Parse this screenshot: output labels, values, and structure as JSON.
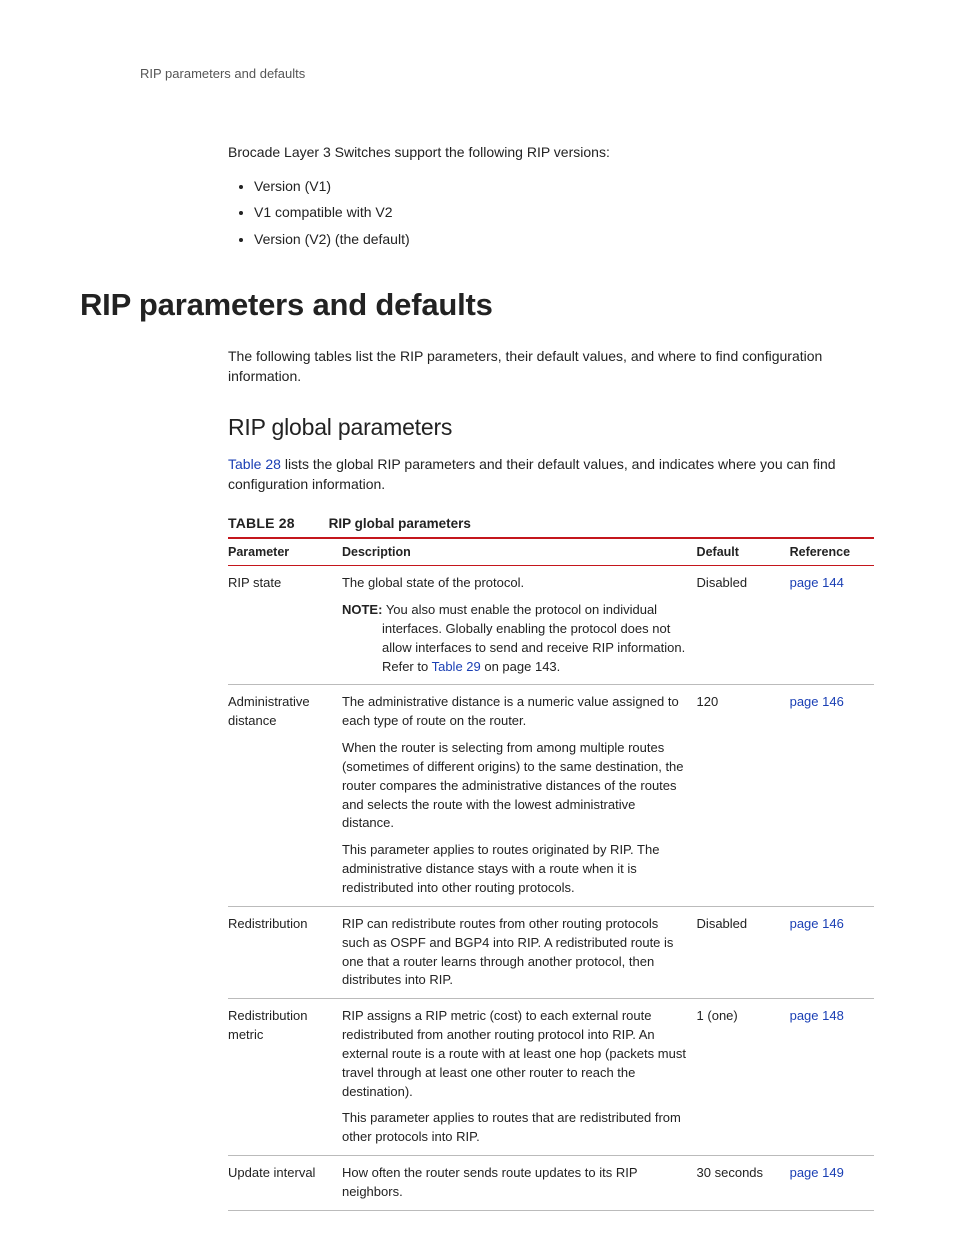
{
  "running_head": "RIP parameters and defaults",
  "intro_sentence": "Brocade Layer 3 Switches support the following RIP versions:",
  "versions": [
    "Version (V1)",
    "V1 compatible with V2",
    "Version (V2) (the default)"
  ],
  "section_heading": "RIP parameters and defaults",
  "section_para": "The following tables list the RIP parameters, their default values, and where to find configuration information.",
  "sub_heading": "RIP global parameters",
  "sub_para_pre_link": "Table 28",
  "sub_para_post_link": " lists the global RIP parameters and their default values, and indicates where you can find configuration information.",
  "table_number": "TABLE 28",
  "table_title": "RIP global parameters",
  "columns": {
    "param": "Parameter",
    "desc": "Description",
    "def": "Default",
    "ref": "Reference"
  },
  "rows": [
    {
      "param": "RIP state",
      "desc_main": "The global state of the protocol.",
      "note_label": "NOTE:",
      "note_text": "You also must enable the protocol on individual interfaces.  Globally enabling the protocol does not allow interfaces to send and receive RIP information.  Refer to ",
      "note_link": "Table 29",
      "note_tail": " on page 143.",
      "default": "Disabled",
      "reference": "page 144"
    },
    {
      "param": "Administrative distance",
      "desc_main": "The administrative distance is a numeric value assigned to each type of route on the router.",
      "desc_extra": "When the router is selecting from among multiple routes (sometimes of different origins) to the same destination, the router compares the administrative distances of the routes and selects the route with the lowest administrative distance.",
      "desc_extra2": "This parameter applies to routes originated by RIP.  The administrative distance stays with a route when it is redistributed into other routing protocols.",
      "default": "120",
      "reference": "page 146"
    },
    {
      "param": "Redistribution",
      "desc_main": "RIP can redistribute routes from other routing protocols such as OSPF and BGP4 into RIP.  A redistributed route is one that a router learns through another protocol, then distributes into RIP.",
      "default": "Disabled",
      "reference": "page 146"
    },
    {
      "param": "Redistribution metric",
      "desc_main": "RIP assigns a RIP metric (cost) to each external route redistributed from another routing protocol into RIP.  An external route is a route with at least one hop (packets must travel through at least one other router to reach the destination).",
      "desc_extra": "This parameter applies to routes that are redistributed from other protocols into RIP.",
      "default": "1 (one)",
      "reference": "page 148"
    },
    {
      "param": "Update interval",
      "desc_main": "How often the router sends route updates to its RIP neighbors.",
      "default": "30 seconds",
      "reference": "page 149"
    }
  ]
}
